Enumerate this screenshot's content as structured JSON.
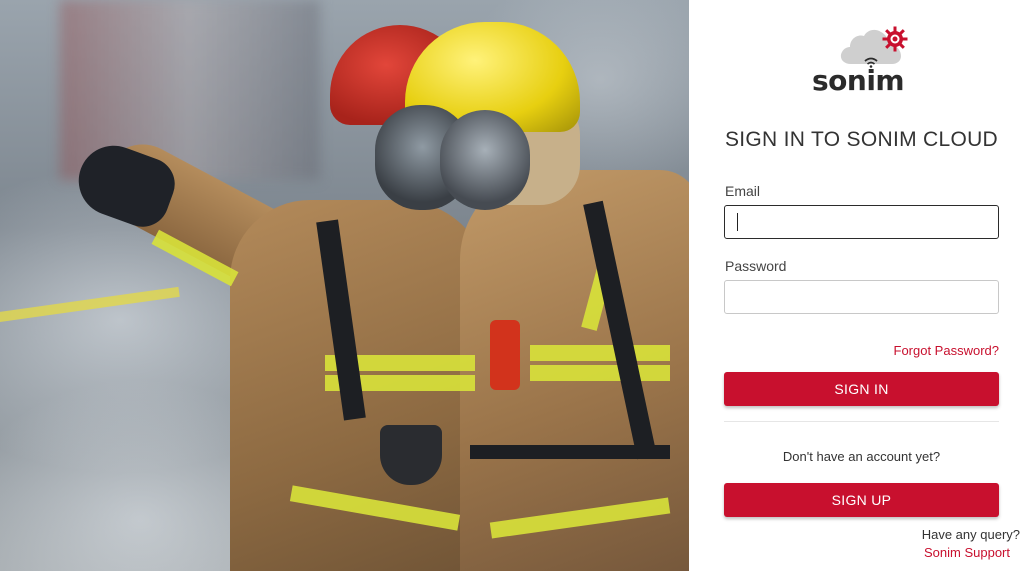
{
  "brand": {
    "wordmark": "sonim",
    "accent_color": "#c8102e"
  },
  "hero": {
    "icon": "firefighters-photo"
  },
  "form": {
    "title": "SIGN IN TO SONIM CLOUD",
    "email_label": "Email",
    "email_value": "",
    "password_label": "Password",
    "password_value": "",
    "forgot_link": "Forgot Password?",
    "sign_in_button": "SIGN IN",
    "no_account_text": "Don't have an account yet?",
    "sign_up_button": "SIGN UP"
  },
  "footer": {
    "query_text": "Have any query?",
    "support_link": "Sonim Support"
  }
}
